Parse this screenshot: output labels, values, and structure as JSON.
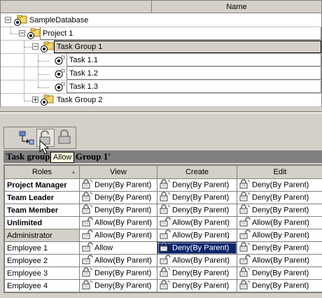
{
  "tree": {
    "header_label": "Name",
    "nodes": [
      {
        "label": "SampleDatabase",
        "expander": "−"
      },
      {
        "label": "Project 1",
        "expander": "−"
      },
      {
        "label": "Task Group 1",
        "expander": "−",
        "selected": true
      },
      {
        "label": "Task 1.1"
      },
      {
        "label": "Task 1.2"
      },
      {
        "label": "Task 1.3"
      },
      {
        "label": "Task Group 2",
        "expander": "+"
      }
    ]
  },
  "toolbar": {
    "buttons": [
      "assign-icon",
      "allow-lock-icon",
      "deny-lock-icon"
    ],
    "tooltip": "Allow"
  },
  "grid": {
    "title": "Task group 'Task Group 1'",
    "columns": [
      "Roles",
      "View",
      "Create",
      "Edit"
    ],
    "rows": [
      {
        "role": "Project Manager",
        "bold": true,
        "view": "Deny(By Parent)",
        "create": "Deny(By Parent)",
        "edit": "Deny(By Parent)"
      },
      {
        "role": "Team Leader",
        "bold": true,
        "view": "Deny(By Parent)",
        "create": "Deny(By Parent)",
        "edit": "Deny(By Parent)"
      },
      {
        "role": "Team Member",
        "bold": true,
        "view": "Deny(By Parent)",
        "create": "Deny(By Parent)",
        "edit": "Deny(By Parent)"
      },
      {
        "role": "Unlimited",
        "bold": true,
        "view": "Allow(By Parent)",
        "create": "Allow(By Parent)",
        "edit": "Allow(By Parent)"
      },
      {
        "role": "Administrator",
        "gray": true,
        "view": "Allow(By Parent)",
        "create": "Allow(By Parent)",
        "edit": "Allow(By Parent)"
      },
      {
        "role": "Employee 1",
        "view": "Allow",
        "create": "Deny(By Parent)",
        "edit": "Deny(By Parent)",
        "create_selected": true
      },
      {
        "role": "Employee 2",
        "view": "Allow(By Parent)",
        "create": "Allow(By Parent)",
        "edit": "Allow(By Parent)"
      },
      {
        "role": "Employee 3",
        "view": "Deny(By Parent)",
        "create": "Deny(By Parent)",
        "edit": "Deny(By Parent)"
      },
      {
        "role": "Employee 4",
        "view": "Deny(By Parent)",
        "create": "Deny(By Parent)",
        "edit": "Deny(By Parent)"
      }
    ]
  },
  "colors": {
    "selection": "#0a246a",
    "face": "#d4d0c8"
  }
}
